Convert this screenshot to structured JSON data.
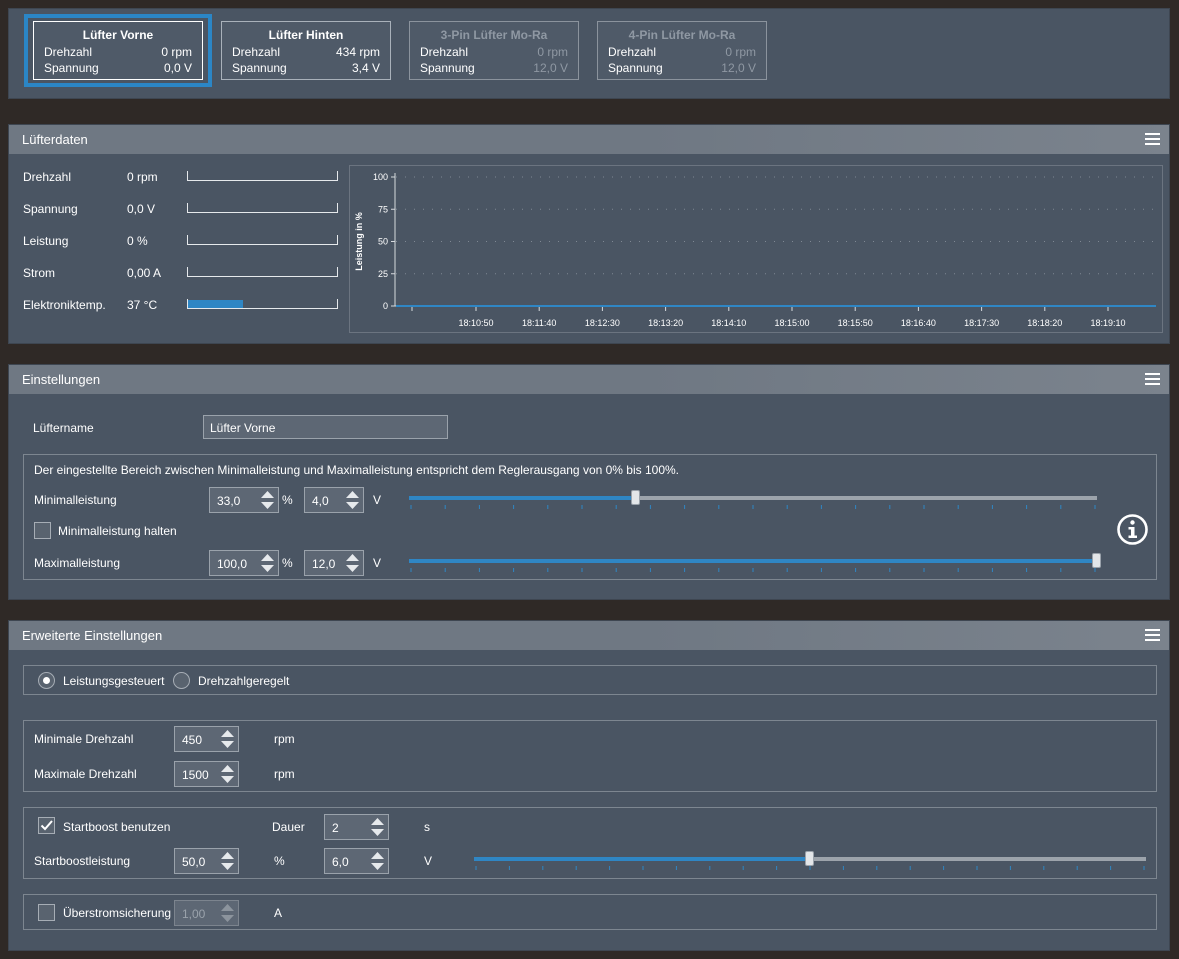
{
  "fans": [
    {
      "name": "Lüfter Vorne",
      "speed_label": "Drehzahl",
      "speed": "0 rpm",
      "voltage_label": "Spannung",
      "voltage": "0,0 V"
    },
    {
      "name": "Lüfter Hinten",
      "speed_label": "Drehzahl",
      "speed": "434 rpm",
      "voltage_label": "Spannung",
      "voltage": "3,4 V"
    },
    {
      "name": "3-Pin Lüfter Mo-Ra",
      "speed_label": "Drehzahl",
      "speed": "0 rpm",
      "voltage_label": "Spannung",
      "voltage": "12,0 V"
    },
    {
      "name": "4-Pin Lüfter Mo-Ra",
      "speed_label": "Drehzahl",
      "speed": "0 rpm",
      "voltage_label": "Spannung",
      "voltage": "12,0 V"
    }
  ],
  "fan_data": {
    "title": "Lüfterdaten",
    "rows": [
      {
        "label": "Drehzahl",
        "value": "0 rpm",
        "level": 0
      },
      {
        "label": "Spannung",
        "value": "0,0 V",
        "level": 0
      },
      {
        "label": "Leistung",
        "value": "0 %",
        "level": 0
      },
      {
        "label": "Strom",
        "value": "0,00 A",
        "level": 0
      },
      {
        "label": "Elektroniktemp.",
        "value": "37 °C",
        "level": 0.37
      }
    ]
  },
  "chart_data": {
    "type": "line",
    "ylabel": "Leistung in %",
    "ylim": [
      0,
      100
    ],
    "yticks": [
      "100",
      "75",
      "50",
      "25",
      "0"
    ],
    "x": [
      "18:10:50",
      "18:11:40",
      "18:12:30",
      "18:13:20",
      "18:14:10",
      "18:15:00",
      "18:15:50",
      "18:16:40",
      "18:17:30",
      "18:18:20",
      "18:19:10"
    ],
    "series": [
      {
        "values": [
          0,
          0,
          0,
          0,
          0,
          0,
          0,
          0,
          0,
          0,
          0
        ],
        "color": "#2f86c4"
      }
    ],
    "grid": true
  },
  "settings": {
    "title": "Einstellungen",
    "name_label": "Lüftername",
    "name_value": "Lüfter Vorne",
    "range_note": "Der eingestellte Bereich zwischen Minimalleistung und Maximalleistung entspricht dem Reglerausgang von 0% bis 100%.",
    "min_label": "Minimalleistung",
    "min_percent": "33,0",
    "min_voltage": "4,0",
    "min_level": 0.33,
    "hold_min_label": "Minimalleistung halten",
    "max_label": "Maximalleistung",
    "max_percent": "100,0",
    "max_voltage": "12,0",
    "max_level": 1.0,
    "percent_unit": "%",
    "voltage_unit": "V"
  },
  "advanced": {
    "title": "Erweiterte Einstellungen",
    "mode_power": "Leistungsgesteuert",
    "mode_speed": "Drehzahlgeregelt",
    "min_speed_label": "Minimale Drehzahl",
    "min_speed": "450",
    "max_speed_label": "Maximale Drehzahl",
    "max_speed": "1500",
    "rpm_unit": "rpm",
    "startboost_label": "Startboost benutzen",
    "duration_label": "Dauer",
    "duration": "2",
    "duration_unit": "s",
    "startboost_power_label": "Startboostleistung",
    "startboost_percent": "50,0",
    "startboost_voltage": "6,0",
    "startboost_level": 0.5,
    "percent_unit": "%",
    "voltage_unit": "V",
    "overcurrent_label": "Überstromsicherung",
    "overcurrent": "1,00",
    "current_unit": "A"
  },
  "colors": {
    "accent": "#2f86c4",
    "panel": "#4a5563",
    "header": "#6f7883",
    "background": "#2f2926"
  }
}
